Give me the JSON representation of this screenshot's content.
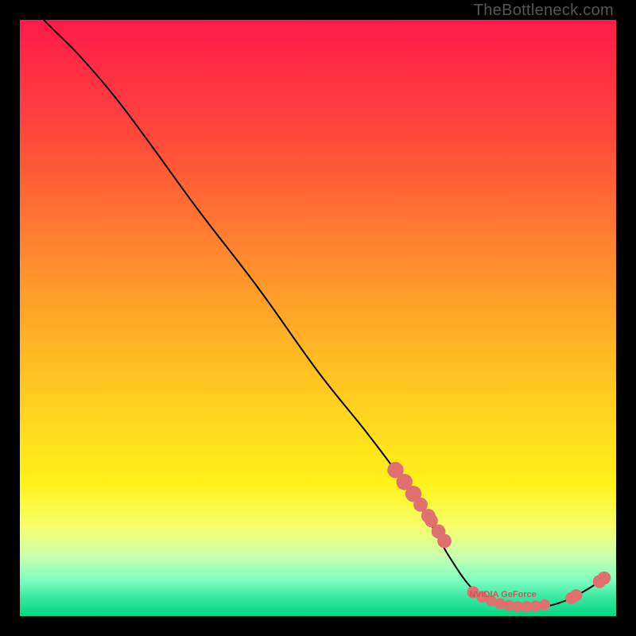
{
  "attribution": "TheBottleneck.com",
  "chart_data": {
    "type": "line",
    "title": "",
    "xlabel": "",
    "ylabel": "",
    "x_range": [
      0,
      100
    ],
    "y_range": [
      0,
      100
    ],
    "gradient_stops": [
      {
        "offset": 0.0,
        "color": "#ff1a4b"
      },
      {
        "offset": 0.2,
        "color": "#ff4a3a"
      },
      {
        "offset": 0.45,
        "color": "#ff9a2a"
      },
      {
        "offset": 0.65,
        "color": "#ffd21f"
      },
      {
        "offset": 0.78,
        "color": "#fff31a"
      },
      {
        "offset": 0.85,
        "color": "#f7ff6a"
      },
      {
        "offset": 0.9,
        "color": "#c9ffb0"
      },
      {
        "offset": 0.94,
        "color": "#7dffbf"
      },
      {
        "offset": 0.97,
        "color": "#35e8a0"
      },
      {
        "offset": 1.0,
        "color": "#00d884"
      }
    ],
    "curve": [
      {
        "x": 4,
        "y": 100
      },
      {
        "x": 6,
        "y": 98
      },
      {
        "x": 10,
        "y": 94
      },
      {
        "x": 16,
        "y": 87
      },
      {
        "x": 22,
        "y": 79
      },
      {
        "x": 30,
        "y": 68
      },
      {
        "x": 40,
        "y": 55
      },
      {
        "x": 50,
        "y": 41
      },
      {
        "x": 58,
        "y": 31
      },
      {
        "x": 64,
        "y": 23
      },
      {
        "x": 68,
        "y": 17
      },
      {
        "x": 72,
        "y": 10
      },
      {
        "x": 76,
        "y": 4.5
      },
      {
        "x": 80,
        "y": 2.2
      },
      {
        "x": 84,
        "y": 1.6
      },
      {
        "x": 88,
        "y": 1.6
      },
      {
        "x": 92,
        "y": 2.8
      },
      {
        "x": 96,
        "y": 5.0
      },
      {
        "x": 98,
        "y": 6.5
      }
    ],
    "annotation": {
      "text": "NVIDIA GeForce",
      "x": 81,
      "y": 3.2
    },
    "highlight_dots_left": [
      {
        "x": 63,
        "y": 24.5,
        "r": 1.6
      },
      {
        "x": 64.5,
        "y": 22.5,
        "r": 1.6
      },
      {
        "x": 66,
        "y": 20.5,
        "r": 1.6
      },
      {
        "x": 67.2,
        "y": 18.7,
        "r": 1.4
      },
      {
        "x": 68.5,
        "y": 16.8,
        "r": 1.4
      },
      {
        "x": 69.0,
        "y": 16.0,
        "r": 1.3
      },
      {
        "x": 70.2,
        "y": 14.2,
        "r": 1.4
      },
      {
        "x": 71.2,
        "y": 12.6,
        "r": 1.4
      }
    ],
    "highlight_dots_bottom": [
      {
        "x": 76.0,
        "y": 4.0,
        "r": 1.2
      },
      {
        "x": 77.5,
        "y": 3.2,
        "r": 1.1
      },
      {
        "x": 79.0,
        "y": 2.6,
        "r": 1.1
      },
      {
        "x": 80.5,
        "y": 2.1,
        "r": 1.1
      },
      {
        "x": 82.0,
        "y": 1.8,
        "r": 1.1
      },
      {
        "x": 83.5,
        "y": 1.6,
        "r": 1.1
      },
      {
        "x": 85.0,
        "y": 1.6,
        "r": 1.1
      },
      {
        "x": 86.5,
        "y": 1.7,
        "r": 1.1
      },
      {
        "x": 88.0,
        "y": 1.9,
        "r": 1.1
      }
    ],
    "highlight_dots_right": [
      {
        "x": 92.5,
        "y": 3.0,
        "r": 1.2
      },
      {
        "x": 93.3,
        "y": 3.5,
        "r": 1.2
      },
      {
        "x": 97.2,
        "y": 5.8,
        "r": 1.3
      },
      {
        "x": 98.0,
        "y": 6.4,
        "r": 1.3
      }
    ]
  }
}
